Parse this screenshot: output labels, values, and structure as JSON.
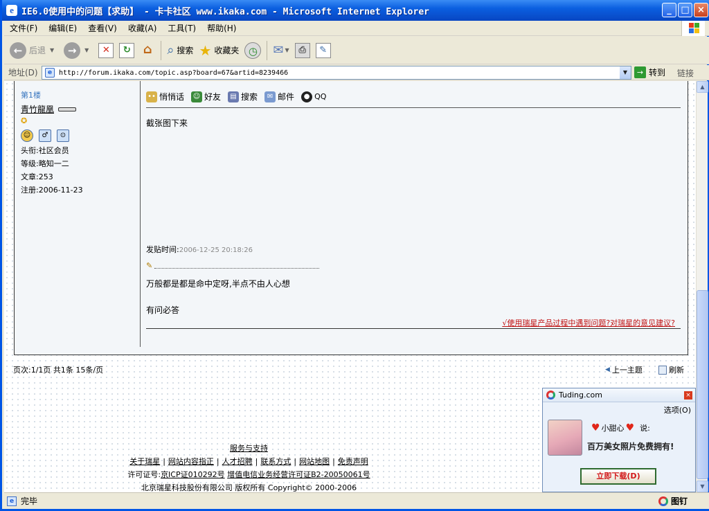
{
  "window": {
    "title": "IE6.0使用中的问题【求助】 - 卡卡社区 www.ikaka.com - Microsoft Internet Explorer",
    "icon": "ie-icon",
    "controls": [
      "minimize",
      "maximize",
      "close"
    ]
  },
  "menu": [
    "文件(F)",
    "编辑(E)",
    "查看(V)",
    "收藏(A)",
    "工具(T)",
    "帮助(H)"
  ],
  "toolbar": {
    "back_label": "后退",
    "search_label": "搜索",
    "favorites_label": "收藏夹"
  },
  "address": {
    "label": "地址(D)",
    "url": "http://forum.ikaka.com/topic.asp?board=67&artid=8239466",
    "go_label": "转到",
    "links_label": "链接"
  },
  "post": {
    "floor": "第1楼",
    "username": "青竹龍凰",
    "title_line": "头衔:社区会员",
    "level_line": "等级:略知一二",
    "articles_line": "文章:253",
    "registered_line": "注册:2006-11-23",
    "actions": [
      "悄悄话",
      "好友",
      "搜索",
      "邮件",
      "QQ"
    ],
    "body": "截张图下来",
    "time_label": "发贴时间:",
    "time_value": "2006-12-25 20:18:26",
    "signature_1": "万般都是都是命中定呀,半点不由人心想",
    "signature_2": "有问必答",
    "feedback_link": "√使用瑞星产品过程中遇到问题?对瑞星的意见建议?"
  },
  "pager": {
    "text": "页次:1/1页 共1条 15条/页",
    "prev_topic": "上一主题",
    "refresh": "刷新"
  },
  "footer": {
    "service_link": "服务与支持",
    "links": [
      "关于瑞星",
      "网站内容指正",
      "人才招聘",
      "联系方式",
      "网站地图",
      "免责声明"
    ],
    "license_prefix": "许可证号:",
    "icp_link": "京ICP证010292号",
    "license_link": "增值电信业务经营许可证B2-20050061号",
    "copyright": "北京瑞星科技股份有限公司  版权所有 Copyright© 2000-2006"
  },
  "popup": {
    "title": "Tuding.com",
    "options": "选项(O)",
    "sender": "小甜心",
    "says": "说:",
    "promo": "百万美女照片免费拥有!",
    "download_button": "立即下载(D)",
    "brand": "图钉"
  },
  "status": {
    "text": "完毕"
  },
  "colors": {
    "titlebar": "#0b5fe0",
    "feedback_link": "#c01010",
    "floor_label": "#3b78c0"
  }
}
